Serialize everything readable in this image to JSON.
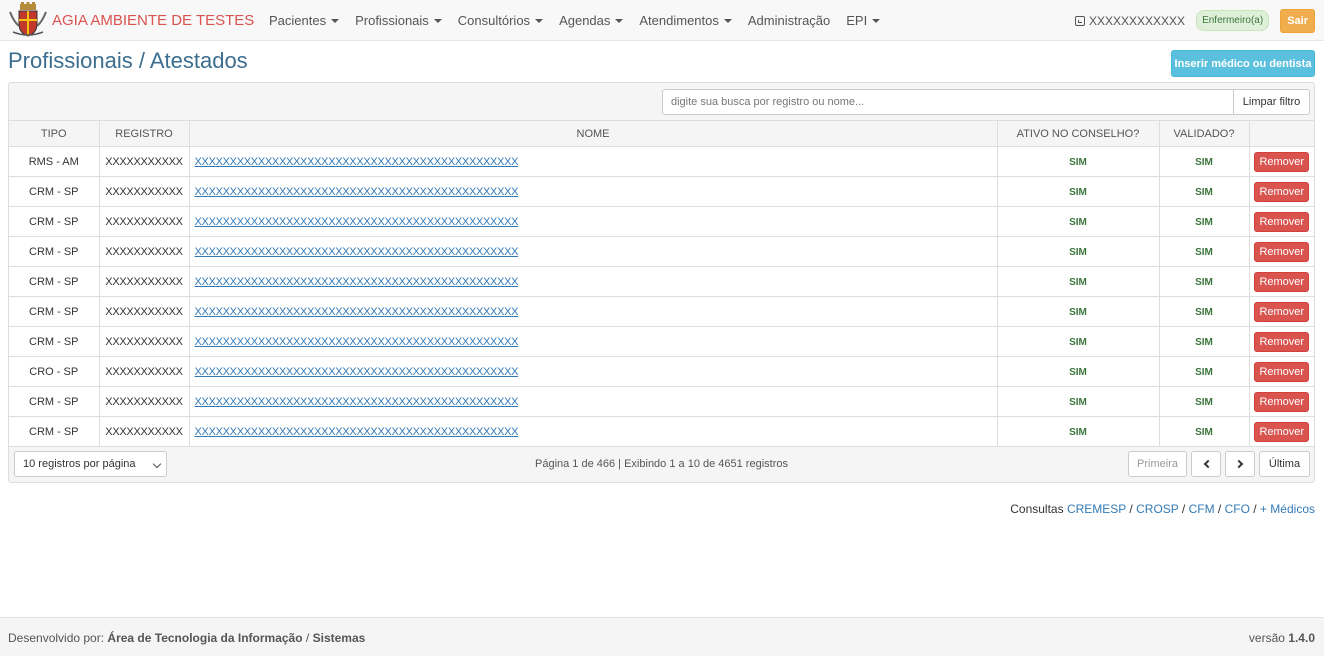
{
  "navbar": {
    "brand_agia": "AGIA",
    "brand_env": "AMBIENTE DE TESTES",
    "menu": [
      {
        "label": "Pacientes",
        "dropdown": true
      },
      {
        "label": "Profissionais",
        "dropdown": true
      },
      {
        "label": "Consultórios",
        "dropdown": true
      },
      {
        "label": "Agendas",
        "dropdown": true
      },
      {
        "label": "Atendimentos",
        "dropdown": true
      },
      {
        "label": "Administração",
        "dropdown": false
      },
      {
        "label": "EPI",
        "dropdown": true
      }
    ],
    "user_name": "XXXXXXXXXXXX",
    "role": "Enfermeiro(a)",
    "logout_label": "Sair"
  },
  "page": {
    "title": "Profissionais / Atestados",
    "insert_button": "Inserir médico ou dentista"
  },
  "search": {
    "placeholder": "digite sua busca por registro ou nome...",
    "value": "",
    "clear_label": "Limpar filtro"
  },
  "table": {
    "headers": [
      "TIPO",
      "REGISTRO",
      "NOME",
      "ATIVO NO CONSELHO?",
      "VALIDADO?",
      ""
    ],
    "remove_label": "Remover",
    "rows": [
      {
        "tipo": "RMS - AM",
        "registro": "XXXXXXXXXXX",
        "nome": "XXXXXXXXXXXXXXXXXXXXXXXXXXXXXXXXXXXXXXXXXXXXXX",
        "ativo": "SIM",
        "validado": "SIM"
      },
      {
        "tipo": "CRM - SP",
        "registro": "XXXXXXXXXXX",
        "nome": "XXXXXXXXXXXXXXXXXXXXXXXXXXXXXXXXXXXXXXXXXXXXXX",
        "ativo": "SIM",
        "validado": "SIM"
      },
      {
        "tipo": "CRM - SP",
        "registro": "XXXXXXXXXXX",
        "nome": "XXXXXXXXXXXXXXXXXXXXXXXXXXXXXXXXXXXXXXXXXXXXXX",
        "ativo": "SIM",
        "validado": "SIM"
      },
      {
        "tipo": "CRM - SP",
        "registro": "XXXXXXXXXXX",
        "nome": "XXXXXXXXXXXXXXXXXXXXXXXXXXXXXXXXXXXXXXXXXXXXXX",
        "ativo": "SIM",
        "validado": "SIM"
      },
      {
        "tipo": "CRM - SP",
        "registro": "XXXXXXXXXXX",
        "nome": "XXXXXXXXXXXXXXXXXXXXXXXXXXXXXXXXXXXXXXXXXXXXXX",
        "ativo": "SIM",
        "validado": "SIM"
      },
      {
        "tipo": "CRM - SP",
        "registro": "XXXXXXXXXXX",
        "nome": "XXXXXXXXXXXXXXXXXXXXXXXXXXXXXXXXXXXXXXXXXXXXXX",
        "ativo": "SIM",
        "validado": "SIM"
      },
      {
        "tipo": "CRM - SP",
        "registro": "XXXXXXXXXXX",
        "nome": "XXXXXXXXXXXXXXXXXXXXXXXXXXXXXXXXXXXXXXXXXXXXXX",
        "ativo": "SIM",
        "validado": "SIM"
      },
      {
        "tipo": "CRO - SP",
        "registro": "XXXXXXXXXXX",
        "nome": "XXXXXXXXXXXXXXXXXXXXXXXXXXXXXXXXXXXXXXXXXXXXXX",
        "ativo": "SIM",
        "validado": "SIM"
      },
      {
        "tipo": "CRM - SP",
        "registro": "XXXXXXXXXXX",
        "nome": "XXXXXXXXXXXXXXXXXXXXXXXXXXXXXXXXXXXXXXXXXXXXXX",
        "ativo": "SIM",
        "validado": "SIM"
      },
      {
        "tipo": "CRM - SP",
        "registro": "XXXXXXXXXXX",
        "nome": "XXXXXXXXXXXXXXXXXXXXXXXXXXXXXXXXXXXXXXXXXXXXXX",
        "ativo": "SIM",
        "validado": "SIM"
      }
    ]
  },
  "pager": {
    "per_page": "10 registros por página",
    "info": "Página 1 de 466 | Exibindo 1 a 10 de 4651 registros",
    "first": "Primeira",
    "last": "Última"
  },
  "consultas": {
    "label": "Consultas",
    "links": [
      "CREMESP",
      "CROSP",
      "CFM",
      "CFO",
      "+ Médicos"
    ]
  },
  "footer": {
    "prefix": "Desenvolvido por:",
    "org": "Área de Tecnologia da Informação",
    "sep": "/",
    "dept": "Sistemas",
    "version_label": "versão",
    "version": "1.4.0"
  },
  "colors": {
    "danger": "#d9534f",
    "info": "#5bc0de",
    "warning": "#f0ad4e",
    "link": "#337ab7",
    "success_text": "#3c763d",
    "title": "#3b6e8f"
  }
}
